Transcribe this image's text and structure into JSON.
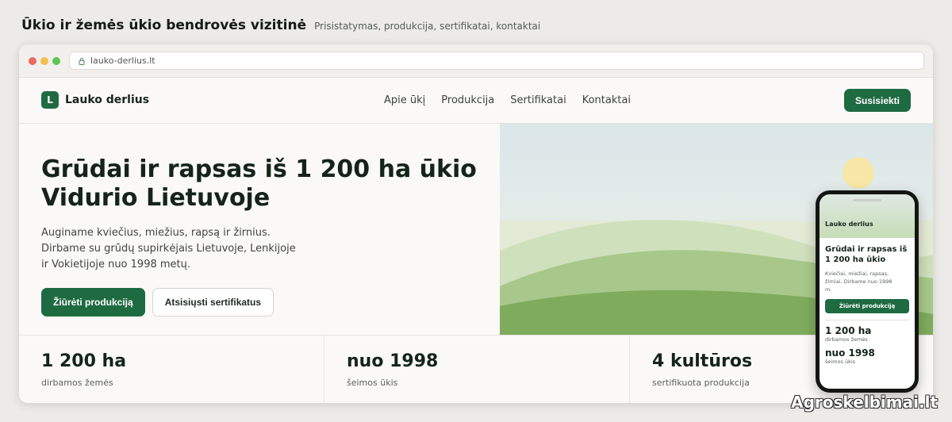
{
  "page": {
    "title": "Ūkio ir žemės ūkio bendrovės vizitinė",
    "subtitle": "Prisistatymas, produkcija, sertifikatai, kontaktai"
  },
  "browser": {
    "url": "lauko-derlius.lt"
  },
  "site": {
    "brand_mark": "L",
    "brand_name": "Lauko derlius",
    "nav": [
      "Apie ūkį",
      "Produkcija",
      "Sertifikatai",
      "Kontaktai"
    ],
    "cta": "Susisiekti"
  },
  "hero": {
    "title_line1": "Grūdai ir rapsas iš 1 200 ha ūkio",
    "title_line2": "Vidurio Lietuvoje",
    "text_line1": "Auginame kviečius, miežius, rapsą ir žirnius.",
    "text_line2": "Dirbame su grūdų supirkėjais Lietuvoje, Lenkijoje",
    "text_line3": "ir Vokietijoje nuo 1998 metų.",
    "primary_button": "Žiūrėti produkciją",
    "secondary_button": "Atsisiųsti sertifikatus"
  },
  "stats": [
    {
      "value": "1 200 ha",
      "label": "dirbamos žemės"
    },
    {
      "value": "nuo 1998",
      "label": "šeimos ūkis"
    },
    {
      "value": "4 kultūros",
      "label": "sertifikuota produkcija"
    }
  ],
  "phone": {
    "brand": "Lauko derlius",
    "title_line1": "Grūdai ir rapsas iš",
    "title_line2": "1 200 ha ūkio",
    "text_line1": "Kviečiai, miežiai, rapsas,",
    "text_line2": "žirniai. Dirbame nuo 1998",
    "text_line3": "m.",
    "button": "Žiūrėti produkciją",
    "stats": [
      {
        "value": "1 200 ha",
        "label": "dirbamos žemės"
      },
      {
        "value": "nuo 1998",
        "label": "šeimos ūkis"
      }
    ]
  },
  "watermark": "Agroskelbimai.lt",
  "colors": {
    "accent": "#1f6b41",
    "background": "#ecebe7",
    "sky": "#dfe9e1",
    "field_light": "#c6dcb8",
    "field_dark": "#7aab59",
    "sun": "#f6e7a6"
  },
  "icons": {
    "lock": "lock-icon"
  }
}
